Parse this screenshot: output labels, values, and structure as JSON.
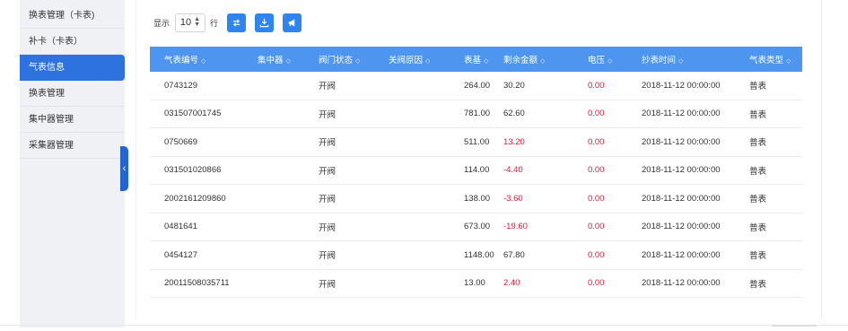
{
  "sidebar": {
    "items": [
      {
        "label": "换表管理（卡表)",
        "active": false
      },
      {
        "label": "补卡（卡表）",
        "active": false
      },
      {
        "label": "气表信息",
        "active": true
      },
      {
        "label": "换表管理",
        "active": false
      },
      {
        "label": "集中器管理",
        "active": false
      },
      {
        "label": "采集器管理",
        "active": false
      }
    ],
    "collapse_glyph": "‹"
  },
  "toolbar": {
    "show_label": "显示",
    "rows_value": "10",
    "rows_unit": "行",
    "buttons": [
      {
        "icon": "switch-icon"
      },
      {
        "icon": "download-icon"
      },
      {
        "icon": "megaphone-icon"
      }
    ]
  },
  "table": {
    "headers": [
      "气表编号",
      "集中器",
      "阀门状态",
      "关阀原因",
      "表基",
      "剩余金额",
      "电压",
      "抄表时间",
      "气表类型"
    ],
    "rows": [
      {
        "meter": "0743129",
        "concentrator": "",
        "valve": "开阀",
        "reason": "",
        "base": "264.00",
        "balance": "30.20",
        "balance_red": false,
        "voltage": "0.00",
        "time": "2018-11-12 00:00:00",
        "type": "普表"
      },
      {
        "meter": "031507001745",
        "concentrator": "",
        "valve": "开阀",
        "reason": "",
        "base": "781.00",
        "balance": "62.60",
        "balance_red": false,
        "voltage": "0.00",
        "time": "2018-11-12 00:00:00",
        "type": "普表"
      },
      {
        "meter": "0750669",
        "concentrator": "",
        "valve": "开阀",
        "reason": "",
        "base": "511.00",
        "balance": "13.20",
        "balance_red": true,
        "voltage": "0.00",
        "time": "2018-11-12 00:00:00",
        "type": "普表"
      },
      {
        "meter": "031501020866",
        "concentrator": "",
        "valve": "开阀",
        "reason": "",
        "base": "114.00",
        "balance": "-4.40",
        "balance_red": true,
        "voltage": "0.00",
        "time": "2018-11-12 00:00:00",
        "type": "普表"
      },
      {
        "meter": "2002161209860",
        "concentrator": "",
        "valve": "开阀",
        "reason": "",
        "base": "138.00",
        "balance": "-3.60",
        "balance_red": true,
        "voltage": "0.00",
        "time": "2018-11-12 00:00:00",
        "type": "普表"
      },
      {
        "meter": "0481641",
        "concentrator": "",
        "valve": "开阀",
        "reason": "",
        "base": "673.00",
        "balance": "-19.60",
        "balance_red": true,
        "voltage": "0.00",
        "time": "2018-11-12 00:00:00",
        "type": "普表"
      },
      {
        "meter": "0454127",
        "concentrator": "",
        "valve": "开阀",
        "reason": "",
        "base": "1148.00",
        "balance": "67.80",
        "balance_red": false,
        "voltage": "0.00",
        "time": "2018-11-12 00:00:00",
        "type": "普表"
      },
      {
        "meter": "20011508035711",
        "concentrator": "",
        "valve": "开阀",
        "reason": "",
        "base": "13.00",
        "balance": "2.40",
        "balance_red": true,
        "voltage": "0.00",
        "time": "2018-11-12 00:00:00",
        "type": "普表"
      }
    ],
    "sort_glyph": "◇"
  },
  "colors": {
    "accent": "#2e72e0",
    "header": "#4e95f0",
    "alert": "#e8173a"
  }
}
